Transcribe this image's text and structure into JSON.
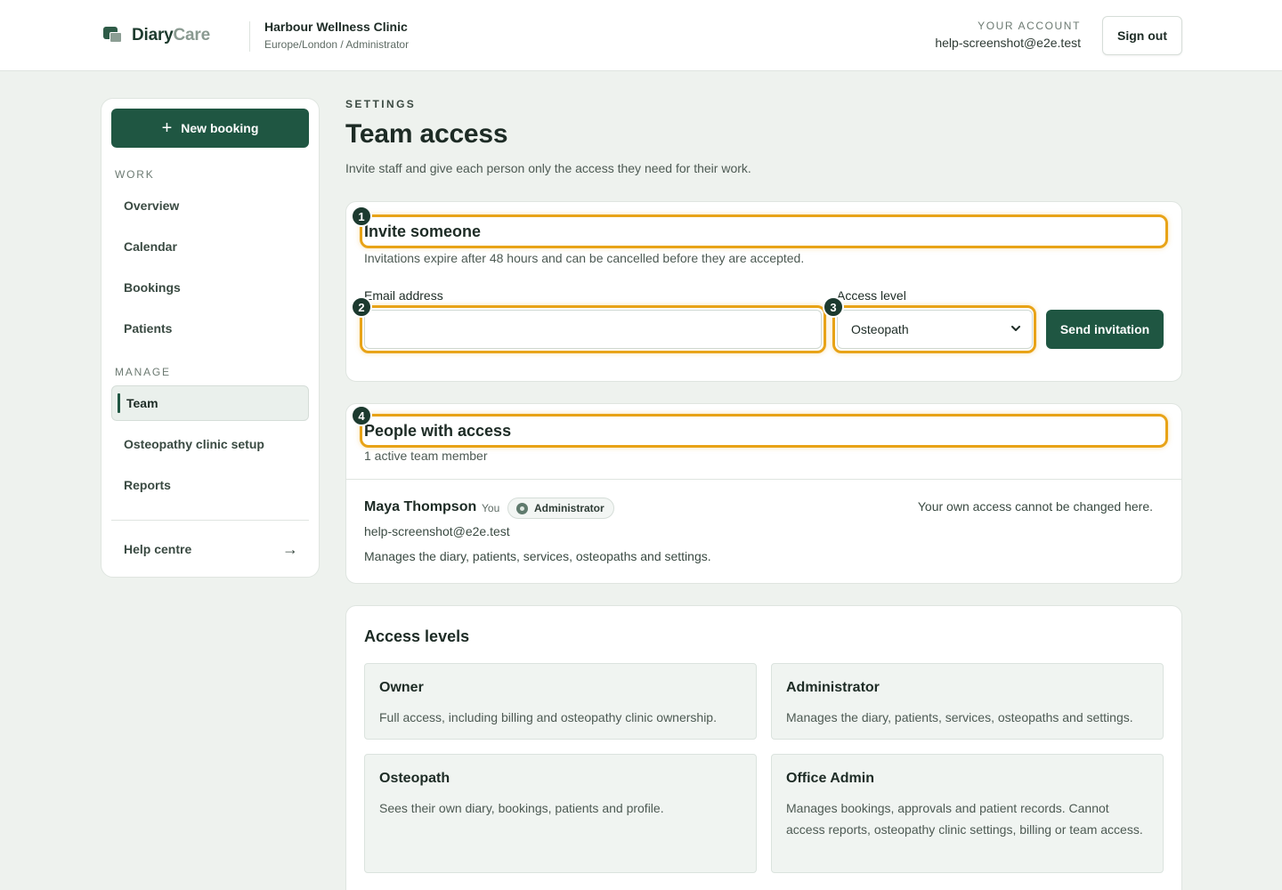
{
  "header": {
    "brand_part1": "Diary",
    "brand_part2": "Care",
    "clinic_name": "Harbour Wellness Clinic",
    "clinic_sub": "Europe/London / Administrator",
    "account_label": "YOUR ACCOUNT",
    "account_email": "help-screenshot@e2e.test",
    "sign_out_label": "Sign out"
  },
  "sidebar": {
    "new_booking_label": "New booking",
    "work_label": "WORK",
    "work_items": [
      "Overview",
      "Calendar",
      "Bookings",
      "Patients"
    ],
    "manage_label": "MANAGE",
    "manage_items": [
      "Team",
      "Osteopathy clinic setup",
      "Reports"
    ],
    "active_item": "Team",
    "help_label": "Help centre"
  },
  "page": {
    "eyebrow": "SETTINGS",
    "title": "Team access",
    "description": "Invite staff and give each person only the access they need for their work."
  },
  "invite": {
    "marker": "1",
    "title": "Invite someone",
    "subtitle": "Invitations expire after 48 hours and can be cancelled before they are accepted.",
    "email_label": "Email address",
    "email_value": "",
    "email_marker": "2",
    "access_label": "Access level",
    "access_value": "Osteopath",
    "access_marker": "3",
    "send_label": "Send invitation"
  },
  "people": {
    "marker": "4",
    "title": "People with access",
    "count_text": "1 active team member",
    "members": [
      {
        "name": "Maya Thompson",
        "you_tag": "You",
        "role": "Administrator",
        "email": "help-screenshot@e2e.test",
        "description": "Manages the diary, patients, services, osteopaths and settings.",
        "note": "Your own access cannot be changed here."
      }
    ]
  },
  "access_levels": {
    "title": "Access levels",
    "levels": [
      {
        "name": "Owner",
        "description": "Full access, including billing and osteopathy clinic ownership."
      },
      {
        "name": "Administrator",
        "description": "Manages the diary, patients, services, osteopaths and settings."
      },
      {
        "name": "Osteopath",
        "description": "Sees their own diary, bookings, patients and profile."
      },
      {
        "name": "Office Admin",
        "description": "Manages bookings, approvals and patient records. Cannot access reports, osteopathy clinic settings, billing or team access."
      }
    ]
  },
  "colors": {
    "primary": "#1f5642",
    "highlight": "#e8a317",
    "background": "#eef2ee"
  }
}
